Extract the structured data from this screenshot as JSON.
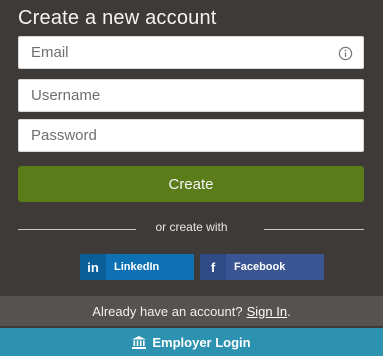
{
  "form": {
    "title": "Create a new account",
    "email_placeholder": "Email",
    "username_placeholder": "Username",
    "password_placeholder": "Password",
    "create_label": "Create",
    "divider_text": "or create with"
  },
  "social": {
    "linkedin_icon_text": "in",
    "linkedin_label": "LinkedIn",
    "facebook_icon_text": "f",
    "facebook_label": "Facebook"
  },
  "footer": {
    "signin_prompt": "Already have an account?",
    "signin_link": "Sign In",
    "signin_suffix": ".",
    "employer_label": "Employer Login"
  },
  "icons": {
    "email_info": "info-icon",
    "employer": "bank-icon"
  },
  "colors": {
    "panel_bg": "#3e3a37",
    "create_button": "#5a7d1a",
    "linkedin": "#0e71b3",
    "facebook": "#3a5591",
    "signin_bar": "#55524f",
    "employer_bar": "#2d92b0"
  }
}
